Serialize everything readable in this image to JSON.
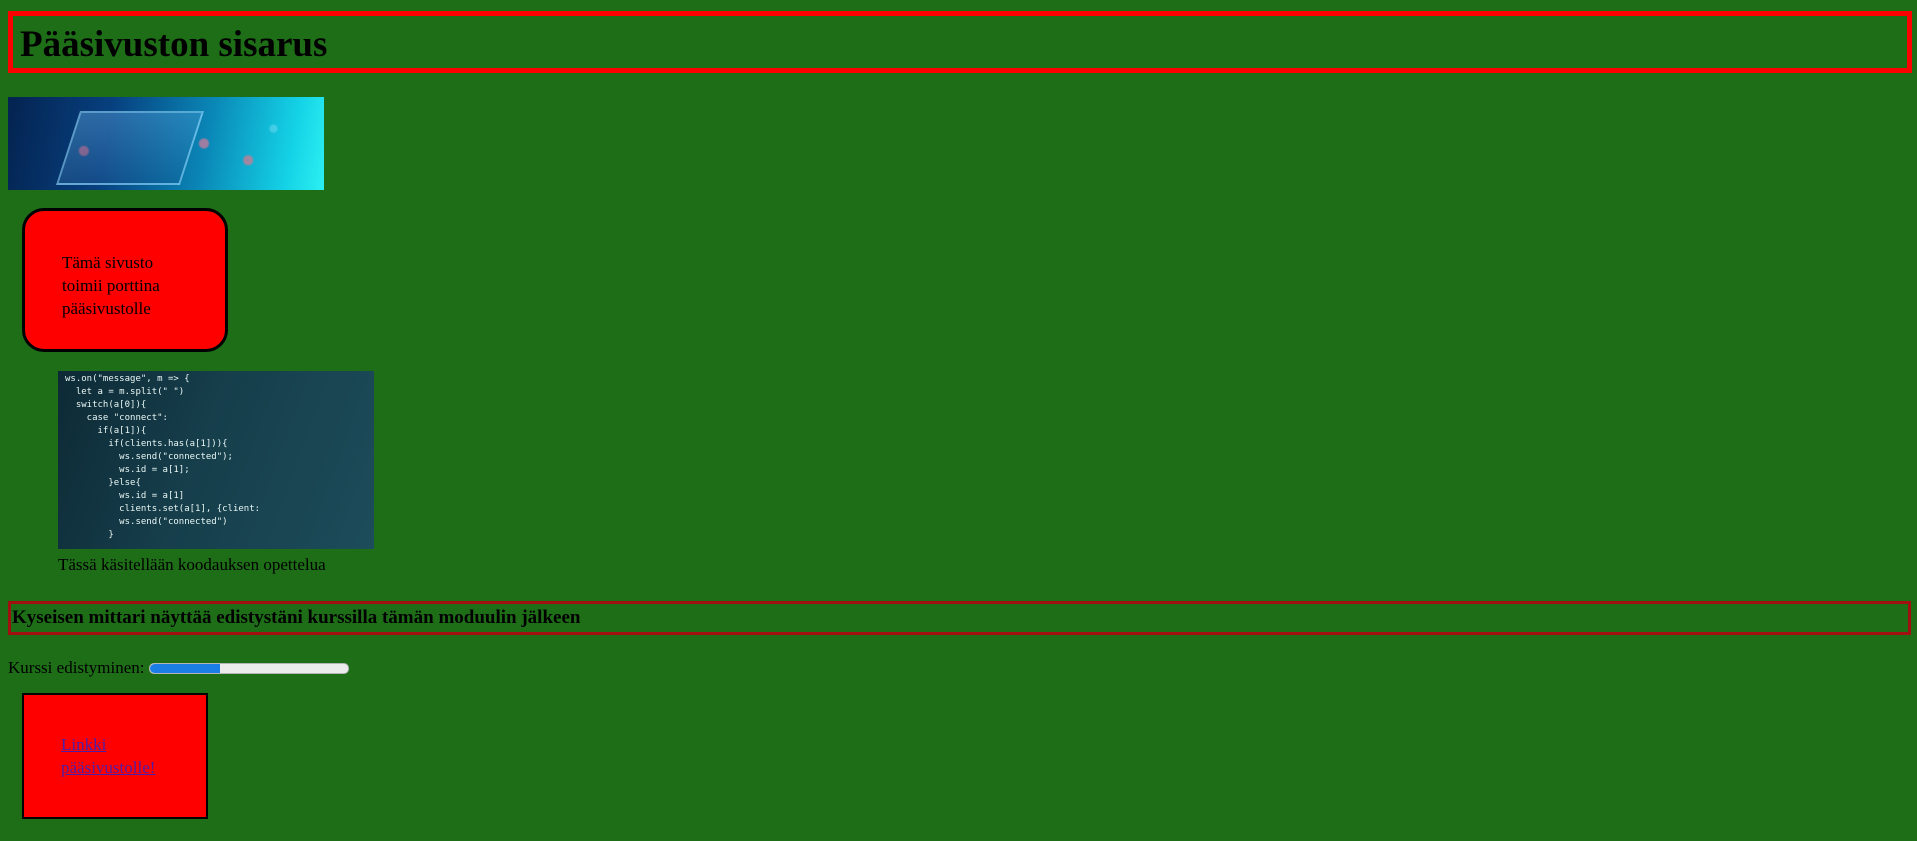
{
  "header": {
    "title": "Pääsivuston sisarus"
  },
  "banner_image": {
    "alt": ""
  },
  "info": {
    "text": "Tämä sivusto toimii porttina pääsivustolle"
  },
  "figure": {
    "code_lines": [
      "ws.on(\"message\", m => {",
      "  let a = m.split(\" \")",
      "  switch(a[0]){",
      "    case \"connect\":",
      "      if(a[1]){",
      "        if(clients.has(a[1])){",
      "          ws.send(\"connected\");",
      "          ws.id = a[1];",
      "        }else{",
      "          ws.id = a[1]",
      "          clients.set(a[1], {client:",
      "          ws.send(\"connected\")",
      "        }"
    ],
    "caption": "Tässä käsitellään koodauksen opettelua"
  },
  "progress_section": {
    "heading": "Kyseisen mittari näyttää edistystäni kurssilla tämän moduulin jälkeen",
    "label": "Kurssi edistyminen:",
    "value": 0.35
  },
  "link": {
    "text": "Linkki pääsivustolle!"
  },
  "colors": {
    "background": "#1e6e18",
    "accent_red": "#ff0000",
    "progress": "#1a7ee6",
    "link": "#4b1fa8"
  }
}
